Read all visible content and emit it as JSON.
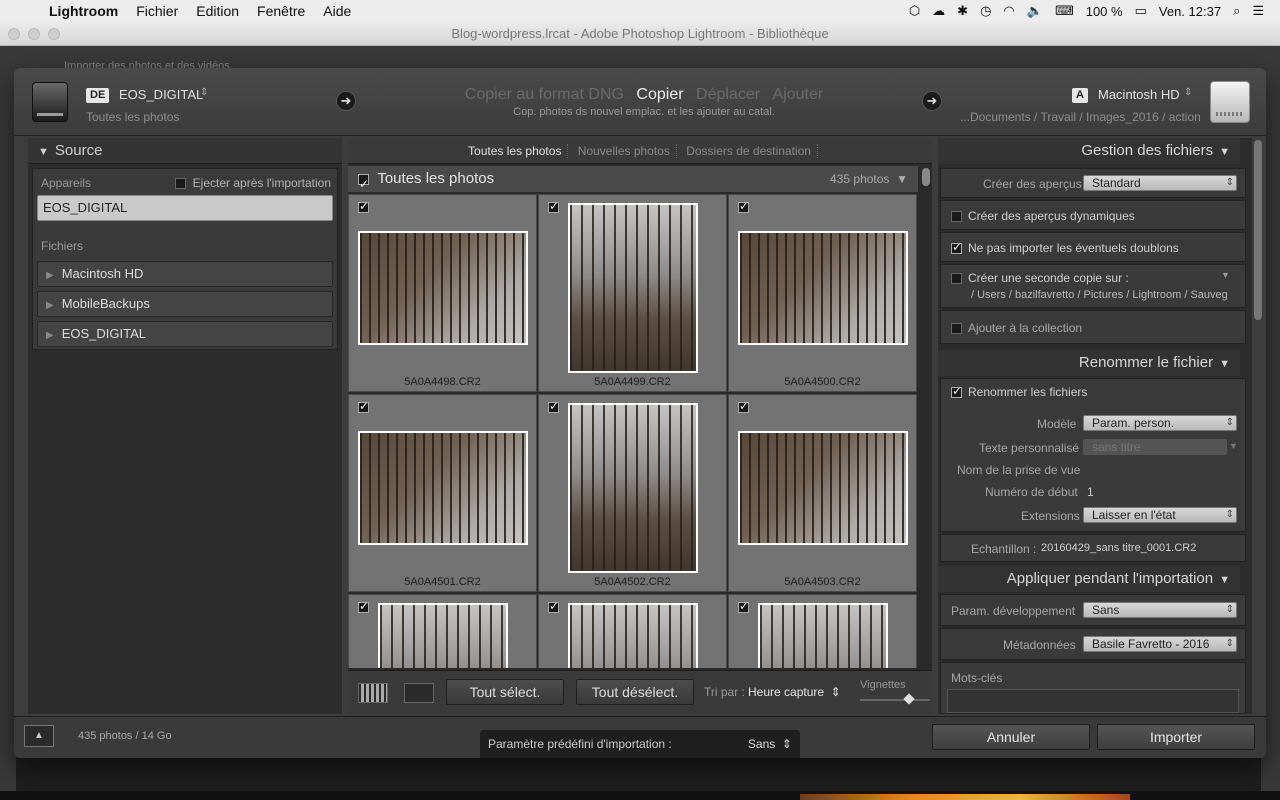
{
  "menubar": {
    "app": "Lightroom",
    "items": [
      "Fichier",
      "Edition",
      "Fenêtre",
      "Aide"
    ],
    "battery": "100 %",
    "clock": "Ven. 12:37"
  },
  "window": {
    "title": "Blog-wordpress.lrcat - Adobe Photoshop Lightroom - Bibliothèque"
  },
  "background": {
    "hint": "Importer des photos et des vidéos"
  },
  "header": {
    "source_badge": "DE",
    "source_name": "EOS_DIGITAL",
    "source_sub": "Toutes les photos",
    "modes": [
      "Copier au format DNG",
      "Copier",
      "Déplacer",
      "Ajouter"
    ],
    "active_mode": "Copier",
    "mode_desc": "Cop. photos ds nouvel emplac. et les ajouter au catal.",
    "dest_badge": "A",
    "dest_name": "Macintosh HD",
    "dest_path": "...Documents / Travail / Images_2016 / action"
  },
  "source_panel": {
    "title": "Source",
    "devices_label": "Appareils",
    "eject_label": "Ejecter après l'importation",
    "device": "EOS_DIGITAL",
    "files_label": "Fichiers",
    "folders": [
      "Macintosh HD",
      "MobileBackups",
      "EOS_DIGITAL"
    ]
  },
  "grid": {
    "filters": [
      "Toutes les photos",
      "Nouvelles photos",
      "Dossiers de destination"
    ],
    "all_label": "Toutes les photos",
    "count": "435 photos",
    "photos": [
      {
        "name": "5A0A4498.CR2",
        "orientation": "landscape"
      },
      {
        "name": "5A0A4499.CR2",
        "orientation": "portrait"
      },
      {
        "name": "5A0A4500.CR2",
        "orientation": "landscape"
      },
      {
        "name": "5A0A4501.CR2",
        "orientation": "landscape"
      },
      {
        "name": "5A0A4502.CR2",
        "orientation": "portrait"
      },
      {
        "name": "5A0A4503.CR2",
        "orientation": "landscape"
      },
      {
        "name": "",
        "orientation": "portrait"
      },
      {
        "name": "",
        "orientation": "portrait"
      },
      {
        "name": "",
        "orientation": "portrait"
      }
    ],
    "select_all": "Tout sélect.",
    "deselect_all": "Tout désélect.",
    "sort_label": "Tri par :",
    "sort_value": "Heure capture",
    "thumbs_label": "Vignettes",
    "thumbs_level": 0.7
  },
  "file_handling": {
    "title": "Gestion des fichiers",
    "previews_label": "Créer des aperçus",
    "previews_value": "Standard",
    "smart_previews": "Créer des aperçus dynamiques",
    "no_duplicates": "Ne pas importer les éventuels doublons",
    "second_copy": "Créer une seconde copie sur :",
    "second_copy_path": "/ Users / bazilfavretto / Pictures / Lightroom / Sauveg",
    "add_collection": "Ajouter à la collection"
  },
  "rename": {
    "title": "Renommer le fichier",
    "rename_files": "Renommer les fichiers",
    "template_label": "Modèle",
    "template_value": "Param. person.",
    "custom_text_label": "Texte personnalisé",
    "custom_text_placeholder": "sans titre",
    "shoot_name_label": "Nom de la prise de vue",
    "start_number_label": "Numéro de début",
    "start_number_value": "1",
    "extensions_label": "Extensions",
    "extensions_value": "Laisser en l'état",
    "sample_label": "Echantillon :",
    "sample_value": "20160429_sans titre_0001.CR2"
  },
  "apply": {
    "title": "Appliquer pendant l'importation",
    "develop_label": "Param. développement",
    "develop_value": "Sans",
    "metadata_label": "Métadonnées",
    "metadata_value": "Basile Favretto - 2016",
    "keywords_label": "Mots-clés"
  },
  "footer": {
    "count": "435 photos / 14 Go",
    "preset_label": "Paramètre prédéfini d'importation :",
    "preset_value": "Sans",
    "cancel": "Annuler",
    "import": "Importer"
  }
}
